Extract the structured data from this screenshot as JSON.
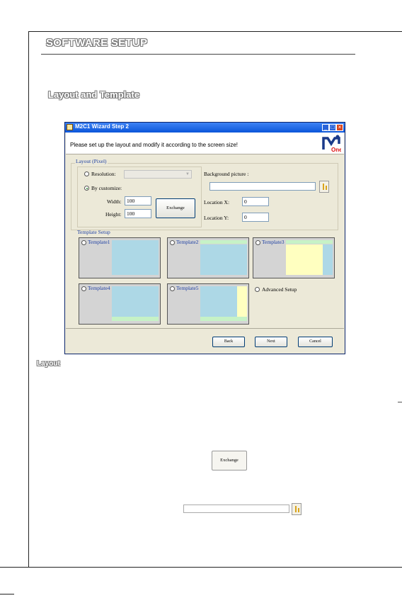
{
  "page": {
    "section_title": "SOFTWARE SETUP",
    "subsection_title": "Layout and Template",
    "figure_caption": "Layout"
  },
  "wizard": {
    "title": "M2C1 Wizard Step 2",
    "instruction": "Please set up the layout and modify it according to the screen size!",
    "logo_text": "One",
    "layout_group": {
      "label": "Layout (Pixel)",
      "resolution_label": "Resolution:",
      "resolution_selected": false,
      "by_customize_label": "By customize:",
      "by_customize_selected": true,
      "width_label": "Width:",
      "width_value": "100",
      "height_label": "Height:",
      "height_value": "100",
      "exchange_button": "Exchange",
      "background_picture_label": "Background picture :",
      "background_picture_value": "",
      "location_x_label": "Location X:",
      "location_x_value": "0",
      "location_y_label": "Location Y:",
      "location_y_value": "0"
    },
    "template_group": {
      "label": "Template Setup",
      "templates": [
        {
          "label": "Template1"
        },
        {
          "label": "Template2"
        },
        {
          "label": "Template3"
        },
        {
          "label": "Template4"
        },
        {
          "label": "Template5"
        }
      ],
      "advanced_label": "Advanced Setup"
    },
    "buttons": {
      "back": "Back",
      "next": "Next",
      "cancel": "Cancel"
    },
    "colors": {
      "titlebar": "#0b55d9",
      "preview_blue": "#add8e6",
      "preview_green": "#c6f2c6",
      "preview_yellow": "#ffffc0",
      "preview_gray": "#d4d4d4"
    }
  },
  "samples": {
    "exchange_button": "Exchange",
    "browse_field_value": ""
  }
}
